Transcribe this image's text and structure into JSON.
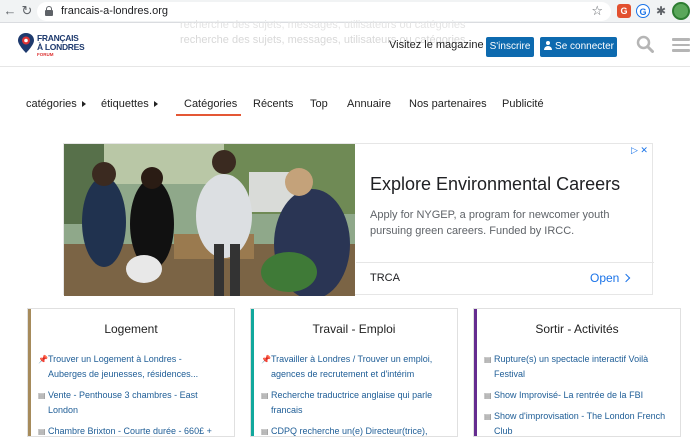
{
  "browser": {
    "url": "francais-a-londres.org"
  },
  "header": {
    "logo_line1": "FRANÇAIS",
    "logo_line2": "À LONDRES",
    "logo_line3": "FORUM",
    "ghost_search": "recherche des sujets, messages, utilisateurs ou catégories",
    "magazine_link": "Visitez le magazine",
    "signup_label": "S'inscrire",
    "login_label": "Se connecter"
  },
  "nav": {
    "items": [
      {
        "label": "catégories",
        "dropdown": true
      },
      {
        "label": "étiquettes",
        "dropdown": true
      },
      {
        "label": "Catégories",
        "active": true
      },
      {
        "label": "Récents"
      },
      {
        "label": "Top"
      },
      {
        "label": "Annuaire"
      },
      {
        "label": "Nos partenaires"
      },
      {
        "label": "Publicité"
      }
    ]
  },
  "ad": {
    "title": "Explore Environmental Careers",
    "description": "Apply for NYGEP, a program for newcomer youth pursuing green careers. Funded by IRCC.",
    "brand": "TRCA",
    "cta": "Open",
    "adchoice": "▷ ✕"
  },
  "categories": [
    {
      "title": "Logement",
      "color": "#a68b5b",
      "topics": [
        {
          "icon": "pin-icon",
          "line1": "Trouver un Logement à Londres -",
          "line2": "Auberges de jeunesses, résidences..."
        },
        {
          "icon": "doc-icon",
          "line1": "Vente - Penthouse 3 chambres - East",
          "line2": "London"
        },
        {
          "icon": "doc-icon",
          "line1": "Chambre Brixton - Courte durée - 660£ +",
          "line2": ""
        }
      ]
    },
    {
      "title": "Travail - Emploi",
      "color": "#12a89d",
      "topics": [
        {
          "icon": "pin-icon",
          "line1": "Travailler à Londres / Trouver un emploi,",
          "line2": "agences de recrutement et d'intérim"
        },
        {
          "icon": "doc-icon",
          "line1": "Recherche traductrice anglaise qui parle",
          "line2": "francais"
        },
        {
          "icon": "doc-icon",
          "line1": "CDPQ recherche un(e) Directeur(trice),",
          "line2": ""
        }
      ]
    },
    {
      "title": "Sortir - Activités",
      "color": "#652d90",
      "topics": [
        {
          "icon": "doc-icon",
          "line1": "Rupture(s) un spectacle interactif Voilà",
          "line2": "Festival"
        },
        {
          "icon": "doc-icon",
          "line1": "Show Improvisé- La rentrée de la FBI",
          "line2": ""
        },
        {
          "icon": "doc-icon",
          "line1": "Show d'improvisation - The London French",
          "line2": "Club"
        }
      ]
    }
  ],
  "colors": {
    "primary_button": "#0d6aaf",
    "active_tab_underline": "#e45735",
    "link": "#1e5d96"
  }
}
